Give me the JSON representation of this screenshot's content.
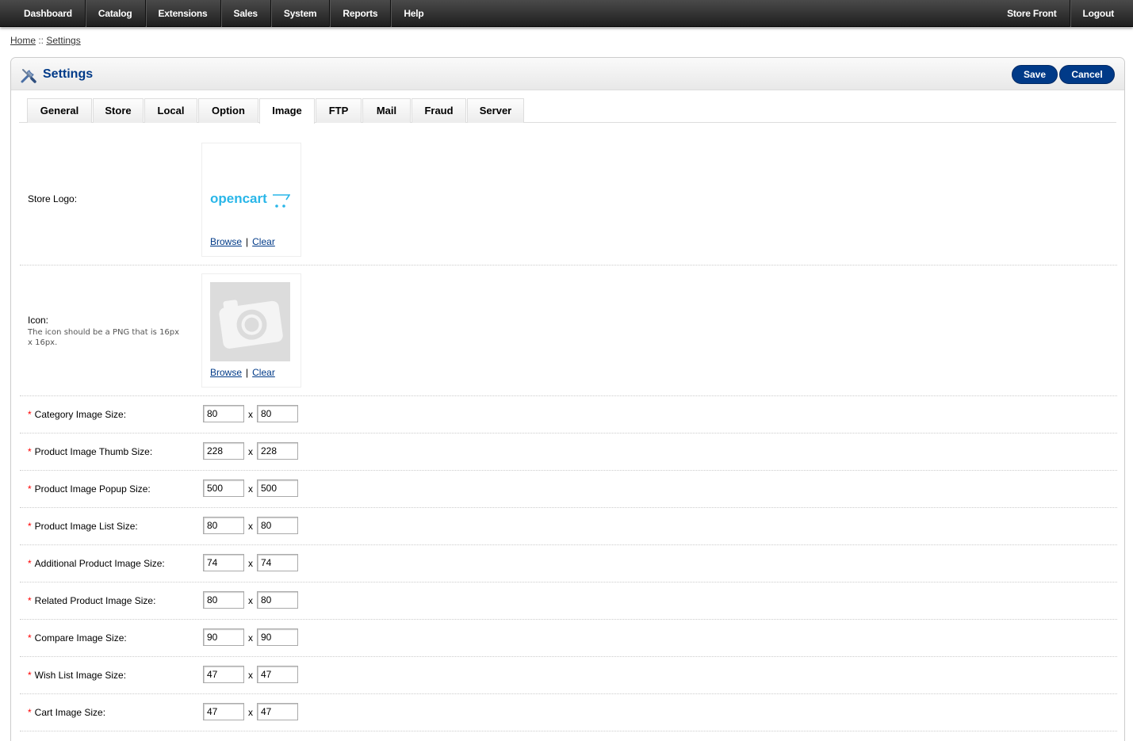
{
  "menu": {
    "left": [
      "Dashboard",
      "Catalog",
      "Extensions",
      "Sales",
      "System",
      "Reports",
      "Help"
    ],
    "right": [
      "Store Front",
      "Logout"
    ]
  },
  "breadcrumb": {
    "home": "Home",
    "separator": " :: ",
    "current": "Settings"
  },
  "heading": {
    "title": "Settings",
    "icon": "settings-tools-icon",
    "save_label": "Save",
    "cancel_label": "Cancel"
  },
  "tabs": [
    "General",
    "Store",
    "Local",
    "Option",
    "Image",
    "FTP",
    "Mail",
    "Fraud",
    "Server"
  ],
  "active_tab": "Image",
  "logo": {
    "label": "Store Logo:",
    "brand_text": "opencart",
    "browse": "Browse",
    "clear": "Clear",
    "separator": "|"
  },
  "icon": {
    "label": "Icon:",
    "help": "The icon should be a PNG that is 16px x 16px.",
    "placeholder_icon": "camera-placeholder-icon",
    "browse": "Browse",
    "clear": "Clear",
    "separator": "|"
  },
  "sizes": [
    {
      "label": "Category Image Size:",
      "width": "80",
      "height": "80"
    },
    {
      "label": "Product Image Thumb Size:",
      "width": "228",
      "height": "228"
    },
    {
      "label": "Product Image Popup Size:",
      "width": "500",
      "height": "500"
    },
    {
      "label": "Product Image List Size:",
      "width": "80",
      "height": "80"
    },
    {
      "label": "Additional Product Image Size:",
      "width": "74",
      "height": "74"
    },
    {
      "label": "Related Product Image Size:",
      "width": "80",
      "height": "80"
    },
    {
      "label": "Compare Image Size:",
      "width": "90",
      "height": "90"
    },
    {
      "label": "Wish List Image Size:",
      "width": "47",
      "height": "47"
    },
    {
      "label": "Cart Image Size:",
      "width": "47",
      "height": "47"
    }
  ],
  "required_mark": "*",
  "size_separator": "x",
  "colors": {
    "accent": "#003a88",
    "required": "#ff0000",
    "logo": "#29b6e8"
  }
}
